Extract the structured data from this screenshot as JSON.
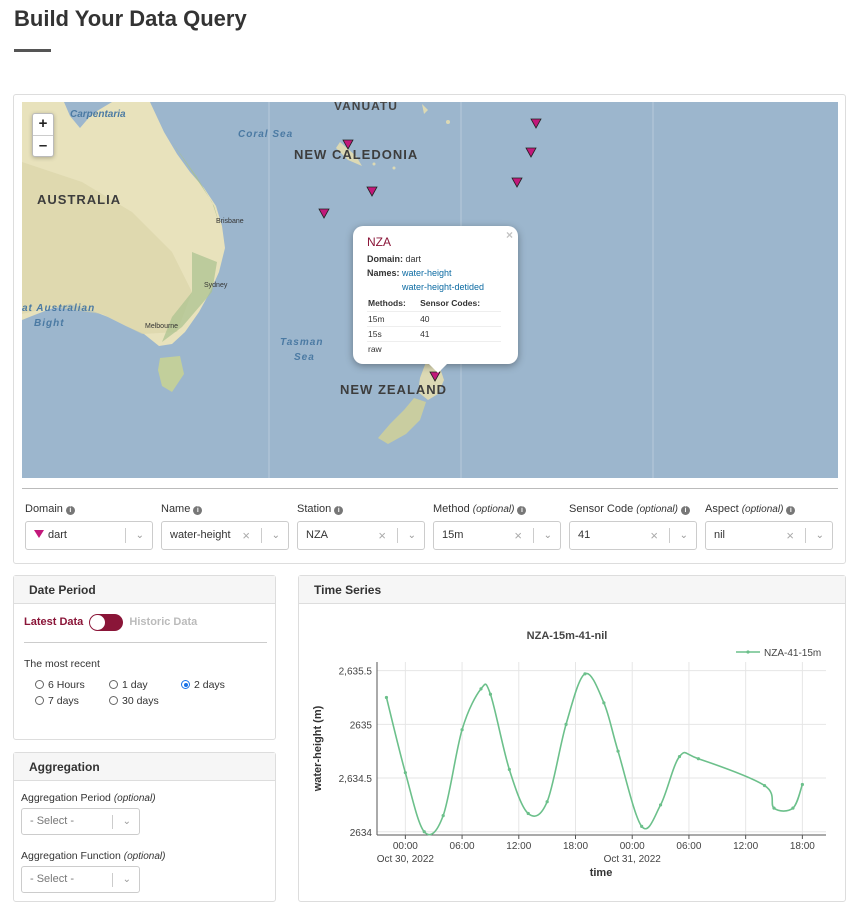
{
  "page": {
    "title": "Build Your Data Query"
  },
  "map": {
    "zoom_in": "+",
    "zoom_out": "–",
    "labels": {
      "carpentaria": "Carpentaria",
      "coral_sea": "Coral Sea",
      "vanuatu": "VANUATU",
      "new_caledonia": "NEW CALEDONIA",
      "australia": "AUSTRALIA",
      "brisbane": "Brisbane",
      "sydney": "Sydney",
      "bight_1": "at Australian",
      "bight_2": "Bight",
      "melbourne": "Melbourne",
      "tasman_1": "Tasman",
      "tasman_2": "Sea",
      "new_zealand": "NEW ZEALAND"
    },
    "marker_color": "#c2187a",
    "popup": {
      "close": "×",
      "title": "NZA",
      "domain_label": "Domain:",
      "domain_value": "dart",
      "names_label": "Names:",
      "names": [
        "water-height",
        "water-height-detided"
      ],
      "methods_header": "Methods:",
      "codes_header": "Sensor Codes:",
      "methods": [
        "15m",
        "15s",
        "raw"
      ],
      "codes": [
        "40",
        "41",
        ""
      ]
    }
  },
  "filters": {
    "domain": {
      "label": "Domain",
      "value": "dart"
    },
    "name": {
      "label": "Name",
      "value": "water-height"
    },
    "station": {
      "label": "Station",
      "value": "NZA"
    },
    "method": {
      "label": "Method",
      "optional": "(optional)",
      "value": "15m"
    },
    "sensor_code": {
      "label": "Sensor Code",
      "optional": "(optional)",
      "value": "41"
    },
    "aspect": {
      "label": "Aspect",
      "optional": "(optional)",
      "value": "nil"
    }
  },
  "date_period": {
    "title": "Date Period",
    "latest": "Latest Data",
    "historic": "Historic Data",
    "recent_label": "The most recent",
    "options": [
      "6 Hours",
      "1 day",
      "2 days",
      "7 days",
      "30 days"
    ],
    "selected": "2 days"
  },
  "aggregation": {
    "title": "Aggregation",
    "period_label": "Aggregation Period",
    "function_label": "Aggregation Function",
    "optional": "(optional)",
    "placeholder": "- Select -"
  },
  "time_series": {
    "title": "Time Series"
  },
  "colors": {
    "accent": "#8a1538",
    "series": "#6cc08b",
    "marker": "#c2187a"
  },
  "chart_data": {
    "type": "line",
    "title": "NZA-15m-41-nil",
    "xlabel": "time",
    "ylabel": "water-height (m)",
    "legend": "top-right",
    "ylim": [
      2633.97,
      2635.58
    ],
    "xlim": [
      "2022-10-29 21:00",
      "2022-10-31 20:30"
    ],
    "x_tick_labels": [
      "00:00",
      "06:00",
      "12:00",
      "18:00",
      "00:00",
      "06:00",
      "12:00",
      "18:00"
    ],
    "x_date_labels": [
      "Oct 30, 2022",
      "Oct 31, 2022"
    ],
    "y_tick_labels": [
      "2634",
      "2,634.5",
      "2635",
      "2,635.5"
    ],
    "y_ticks": [
      2634,
      2634.5,
      2635,
      2635.5
    ],
    "grid": true,
    "series": [
      {
        "name": "NZA-41-15m",
        "x": [
          "2022-10-29 22:00",
          "2022-10-30 00:00",
          "2022-10-30 02:00",
          "2022-10-30 04:00",
          "2022-10-30 06:00",
          "2022-10-30 08:00",
          "2022-10-30 09:00",
          "2022-10-30 11:00",
          "2022-10-30 13:00",
          "2022-10-30 15:00",
          "2022-10-30 17:00",
          "2022-10-30 19:00",
          "2022-10-30 21:00",
          "2022-10-30 22:30",
          "2022-10-31 01:00",
          "2022-10-31 03:00",
          "2022-10-31 05:00",
          "2022-10-31 07:00",
          "2022-10-31 14:00",
          "2022-10-31 15:00",
          "2022-10-31 17:00",
          "2022-10-31 18:00"
        ],
        "y": [
          2635.25,
          2634.55,
          2634.0,
          2634.15,
          2634.95,
          2635.33,
          2635.28,
          2634.58,
          2634.17,
          2634.28,
          2635.0,
          2635.47,
          2635.2,
          2634.75,
          2634.05,
          2634.25,
          2634.7,
          2634.68,
          2634.43,
          2634.22,
          2634.22,
          2634.44
        ]
      }
    ]
  }
}
